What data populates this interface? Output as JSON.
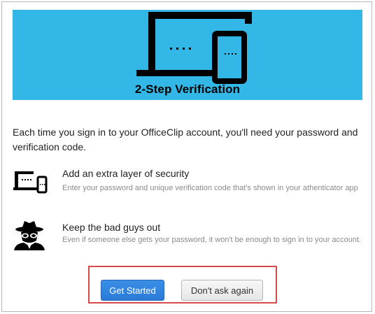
{
  "banner": {
    "title": "2-Step Verification",
    "background_color": "#33b7e6"
  },
  "intro_text": "Each time you sign in to your OfficeClip account, you'll need your password and verification code.",
  "features": [
    {
      "icon": "devices-icon",
      "title": "Add an extra layer of security",
      "description": "Enter your password and unique verification code that's shown in your athenticator app"
    },
    {
      "icon": "spy-icon",
      "title": "Keep the bad guys out",
      "description": "Even if someone else gets your password, it won't be enough to sign in to your account."
    }
  ],
  "actions": {
    "get_started_label": "Get Started",
    "dont_ask_label": "Don't ask again",
    "highlight_color": "#d94a4a",
    "primary_color": "#2b7bd6"
  }
}
